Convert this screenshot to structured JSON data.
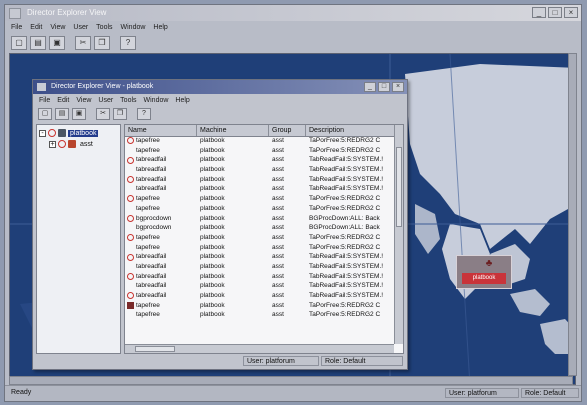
{
  "app": {
    "title": "Director Explorer View",
    "menu": [
      "File",
      "Edit",
      "View",
      "User",
      "Tools",
      "Window",
      "Help"
    ],
    "status_ready": "Ready",
    "status_user": "User: platforum",
    "status_role": "Role: Default"
  },
  "child": {
    "title": "Director Explorer View - platbook",
    "menu": [
      "File",
      "Edit",
      "View",
      "User",
      "Tools",
      "Window",
      "Help"
    ],
    "status_user": "User: platforum",
    "status_role": "Role: Default"
  },
  "tree": [
    {
      "label": "platbook",
      "selected": true,
      "toggle": "-"
    },
    {
      "label": "asst",
      "selected": false,
      "toggle": "+"
    }
  ],
  "list": {
    "columns": [
      "Name",
      "Machine",
      "Group",
      "Description"
    ],
    "rows": [
      {
        "icon": "red-circle",
        "name": "tapefree",
        "machine": "platbook",
        "group": "asst",
        "desc": "TaPorFree:5:REDRG2 C"
      },
      {
        "icon": "none",
        "name": "tapefree",
        "machine": "platbook",
        "group": "asst",
        "desc": "TaPorFree:5:REDRG2 C"
      },
      {
        "icon": "red-circle",
        "name": "tabreadfail",
        "machine": "platbook",
        "group": "asst",
        "desc": "TabReadFail:5:SYSTEM.!"
      },
      {
        "icon": "none",
        "name": "tabreadfail",
        "machine": "platbook",
        "group": "asst",
        "desc": "TabReadFail:5:SYSTEM.!"
      },
      {
        "icon": "red-circle",
        "name": "tabreadfail",
        "machine": "platbook",
        "group": "asst",
        "desc": "TabReadFail:5:SYSTEM.!"
      },
      {
        "icon": "none",
        "name": "tabreadfail",
        "machine": "platbook",
        "group": "asst",
        "desc": "TabReadFail:5:SYSTEM.!"
      },
      {
        "icon": "red-circle",
        "name": "tapefree",
        "machine": "platbook",
        "group": "asst",
        "desc": "TaPorFree:5:REDRG2 C"
      },
      {
        "icon": "none",
        "name": "tapefree",
        "machine": "platbook",
        "group": "asst",
        "desc": "TaPorFree:5:REDRG2 C"
      },
      {
        "icon": "red-circle",
        "name": "bgprocdown",
        "machine": "platbook",
        "group": "asst",
        "desc": "BGProcDown:ALL: Back"
      },
      {
        "icon": "none",
        "name": "bgprocdown",
        "machine": "platbook",
        "group": "asst",
        "desc": "BGProcDown:ALL: Back"
      },
      {
        "icon": "red-circle",
        "name": "tapefree",
        "machine": "platbook",
        "group": "asst",
        "desc": "TaPorFree:5:REDRG2 C"
      },
      {
        "icon": "none",
        "name": "tapefree",
        "machine": "platbook",
        "group": "asst",
        "desc": "TaPorFree:5:REDRG2 C"
      },
      {
        "icon": "red-circle",
        "name": "tabreadfail",
        "machine": "platbook",
        "group": "asst",
        "desc": "TabReadFail:5:SYSTEM.!"
      },
      {
        "icon": "none",
        "name": "tabreadfail",
        "machine": "platbook",
        "group": "asst",
        "desc": "TabReadFail:5:SYSTEM.!"
      },
      {
        "icon": "red-circle",
        "name": "tabreadfail",
        "machine": "platbook",
        "group": "asst",
        "desc": "TabReadFail:5:SYSTEM.!"
      },
      {
        "icon": "none",
        "name": "tabreadfail",
        "machine": "platbook",
        "group": "asst",
        "desc": "TabReadFail:5:SYSTEM.!"
      },
      {
        "icon": "red-circle",
        "name": "tabreadfail",
        "machine": "platbook",
        "group": "asst",
        "desc": "TabReadFail:5:SYSTEM.!"
      },
      {
        "icon": "red-square",
        "name": "tapefree",
        "machine": "platbook",
        "group": "asst",
        "desc": "TaPorFree:5:REDRG2 C"
      },
      {
        "icon": "none",
        "name": "tapefree",
        "machine": "platbook",
        "group": "asst",
        "desc": "TaPorFree:5:REDRG2 C"
      }
    ]
  },
  "map": {
    "marker_label": "platbook",
    "ocean_color": "#1f3f78",
    "land_color": "#d9dde6",
    "alert_color": "#c9343a"
  }
}
